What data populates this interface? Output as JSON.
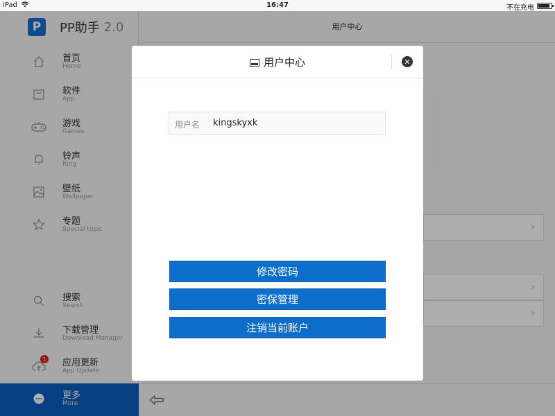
{
  "status_bar": {
    "device": "iPad",
    "time": "16:47",
    "charging_text": "不在充电",
    "battery_level": 0.9
  },
  "sidebar": {
    "brand": {
      "logo_letter": "P",
      "name": "PP助手",
      "version": "2.0"
    },
    "nav_top": [
      {
        "label": "首页",
        "sub": "Home",
        "icon": "home-icon"
      },
      {
        "label": "软件",
        "sub": "App",
        "icon": "bag-icon"
      },
      {
        "label": "游戏",
        "sub": "Games",
        "icon": "gamepad-icon"
      },
      {
        "label": "铃声",
        "sub": "Ring",
        "icon": "bell-icon"
      },
      {
        "label": "壁纸",
        "sub": "Wallpaper",
        "icon": "image-icon"
      },
      {
        "label": "专题",
        "sub": "Special topic",
        "icon": "star-icon"
      }
    ],
    "nav_bottom": [
      {
        "label": "搜索",
        "sub": "Search",
        "icon": "search-icon"
      },
      {
        "label": "下载管理",
        "sub": "Download Manager",
        "icon": "download-icon"
      },
      {
        "label": "应用更新",
        "sub": "App Update",
        "icon": "cloud-upload-icon",
        "badge": "1"
      },
      {
        "label": "更多",
        "sub": "More",
        "icon": "more-icon",
        "active": true
      }
    ]
  },
  "main": {
    "header_title": "用户中心"
  },
  "modal": {
    "title": "用户中心",
    "username_label": "用户名",
    "username_value": "kingskyxk",
    "buttons": [
      "修改密码",
      "密保管理",
      "注销当前账户"
    ]
  },
  "colors": {
    "accent": "#0c6dcb",
    "active_nav": "#0a5fc0",
    "badge": "#d9261c"
  }
}
